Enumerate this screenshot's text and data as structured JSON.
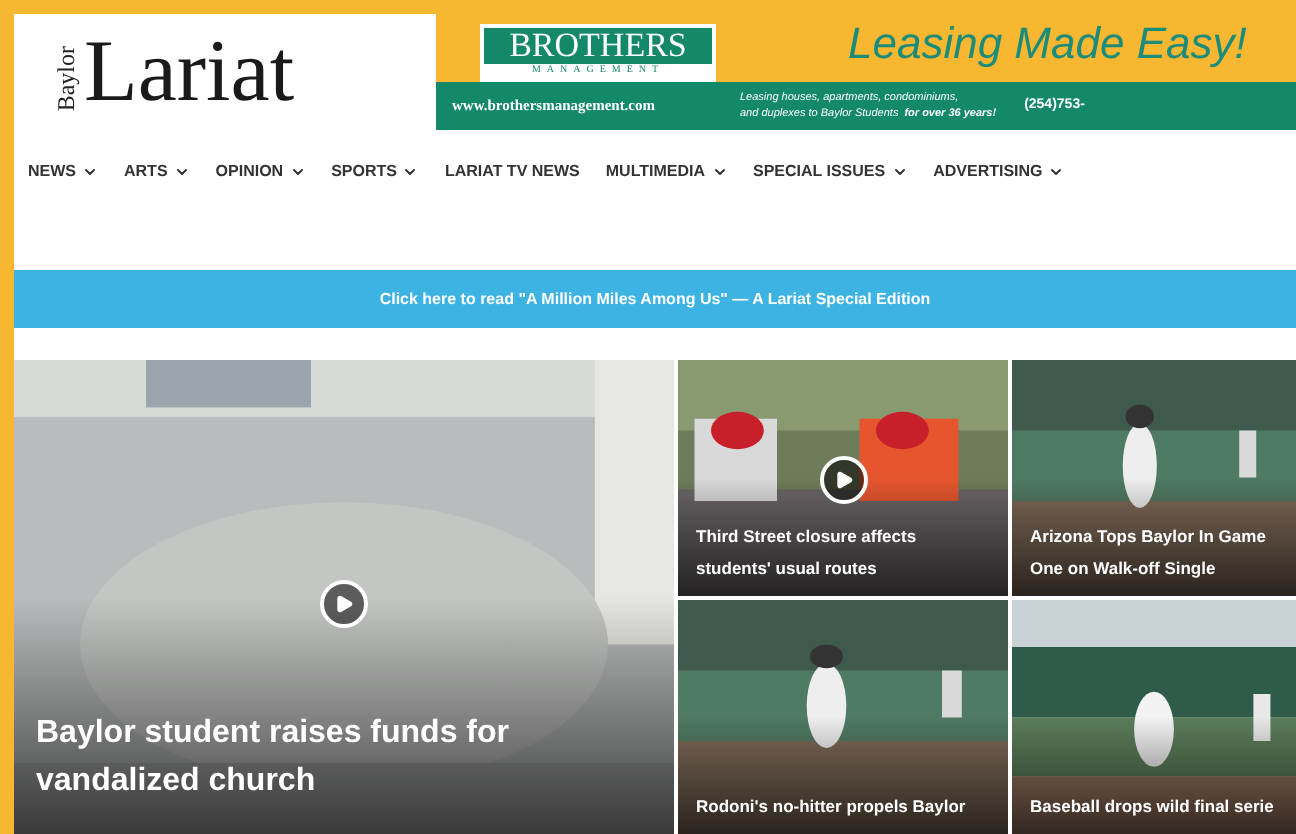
{
  "logo": {
    "small": "Baylor",
    "name": "Lariat"
  },
  "ad": {
    "brand": "BROTHERS",
    "brand_sub": "MANAGEMENT",
    "url": "www.brothersmanagement.com",
    "slogan": "Leasing Made Easy!",
    "blurb_1": "Leasing houses, apartments, condominiums,",
    "blurb_2": "and duplexes to Baylor Students",
    "highlight": "for over 36 years!",
    "phone": "(254)753-"
  },
  "nav": [
    {
      "label": "NEWS",
      "dropdown": true
    },
    {
      "label": "ARTS",
      "dropdown": true
    },
    {
      "label": "OPINION",
      "dropdown": true
    },
    {
      "label": "SPORTS",
      "dropdown": true
    },
    {
      "label": "LARIAT TV NEWS",
      "dropdown": false
    },
    {
      "label": "MULTIMEDIA",
      "dropdown": true
    },
    {
      "label": "SPECIAL ISSUES",
      "dropdown": true
    },
    {
      "label": "ADVERTISING",
      "dropdown": true
    }
  ],
  "banner": "Click here to read \"A Million Miles Among Us\" — A Lariat Special Edition",
  "stories": [
    {
      "headline": "Baylor student raises funds for vandalized church",
      "video": true,
      "kind": "floor"
    },
    {
      "headline": "Third Street closure affects students' usual routes",
      "video": true,
      "kind": "street"
    },
    {
      "headline": "Arizona Tops Baylor In Game One on Walk-off Single",
      "video": false,
      "kind": "field"
    },
    {
      "headline": "Rodoni's no-hitter propels Baylor",
      "video": false,
      "kind": "field"
    },
    {
      "headline": "Baseball drops wild final serie",
      "video": false,
      "kind": "stadium"
    }
  ]
}
